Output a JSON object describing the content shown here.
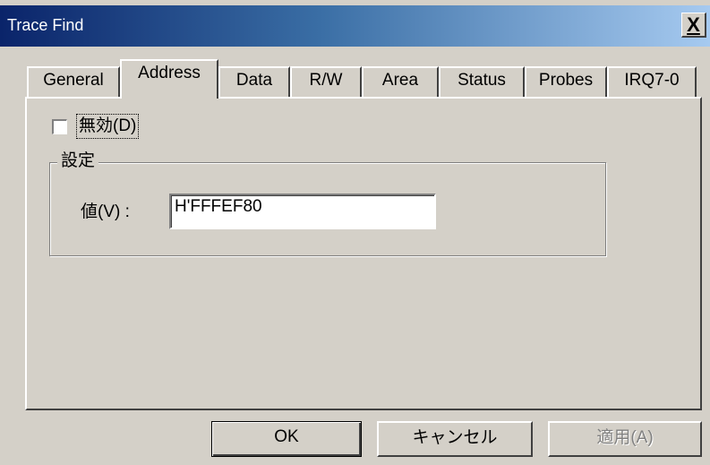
{
  "window": {
    "title": "Trace Find",
    "close_label": "X"
  },
  "tabs": [
    {
      "label": "General"
    },
    {
      "label": "Address",
      "active": true
    },
    {
      "label": "Data"
    },
    {
      "label": "R/W"
    },
    {
      "label": "Area"
    },
    {
      "label": "Status"
    },
    {
      "label": "Probes"
    },
    {
      "label": "IRQ7-0"
    }
  ],
  "disable_checkbox": {
    "label": "無効(D)",
    "checked": false
  },
  "settings_group": {
    "legend": "設定",
    "value_label": "値(V) :",
    "value": "H'FFFEF80"
  },
  "buttons": {
    "ok": "OK",
    "cancel": "キャンセル",
    "apply": "適用(A)"
  },
  "colors": {
    "face": "#d4d0c8",
    "title_start": "#0a246a",
    "title_end": "#a6caf0",
    "disabled_text": "#808080"
  }
}
